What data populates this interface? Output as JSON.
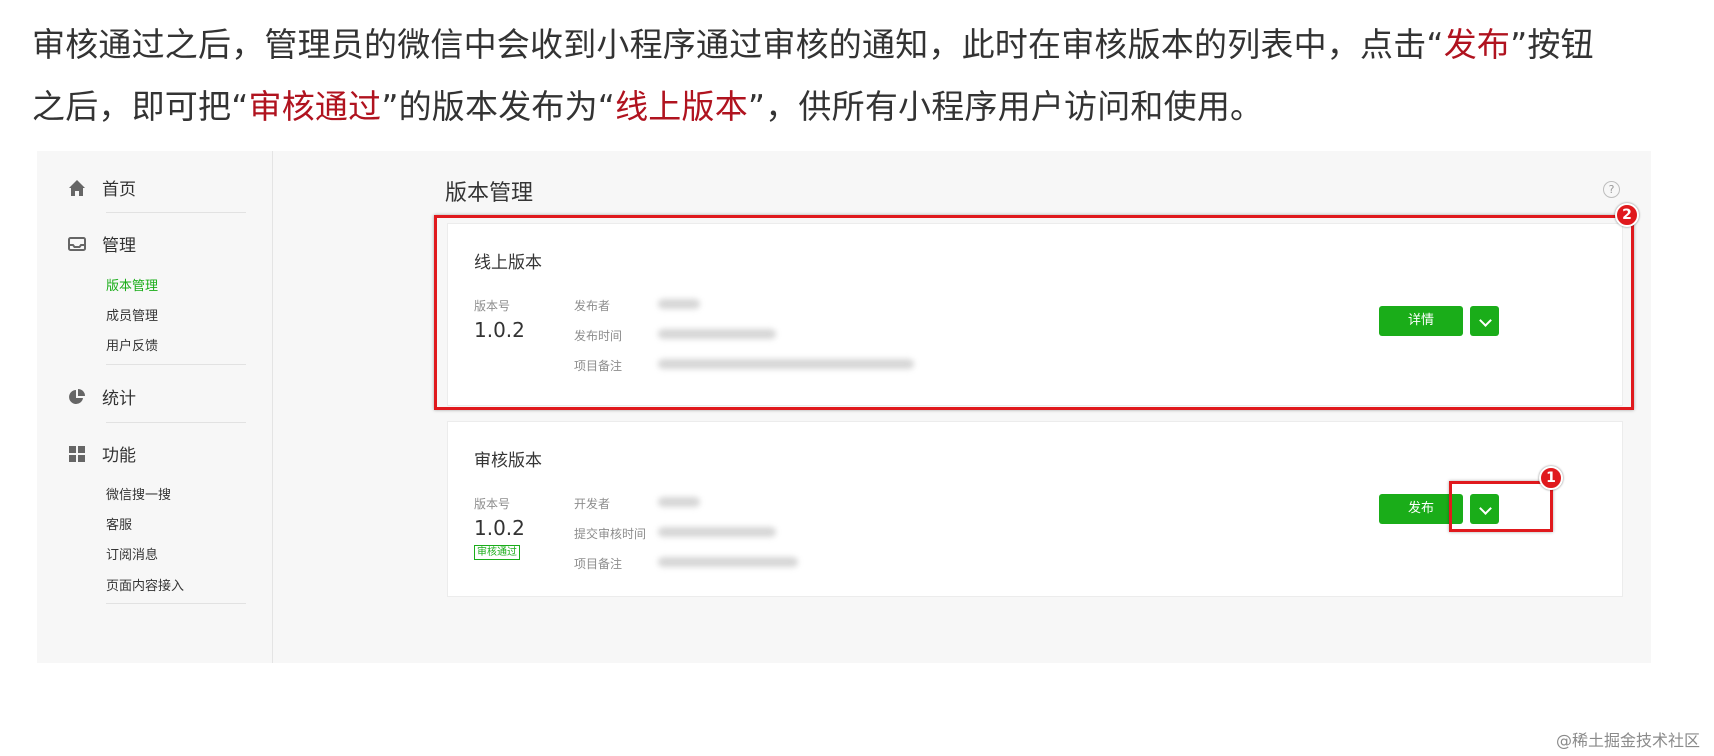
{
  "intro": {
    "line1_a": "审核通过之后，管理员的微信中会收到小程序通过审核的通知，此时在审核版本的列表中，点击“",
    "line1_hl": "发布",
    "line1_b": "”按钮",
    "line2_a": "之后，即可把“",
    "line2_hl1": "审核通过",
    "line2_b": "”的版本发布为“",
    "line2_hl2": "线上版本",
    "line2_c": "”，供所有小程序用户访问和使用。"
  },
  "sidebar": {
    "home": "首页",
    "manage": "管理",
    "manage_items": [
      "版本管理",
      "成员管理",
      "用户反馈"
    ],
    "stats": "统计",
    "features": "功能",
    "feature_items": [
      "微信搜一搜",
      "客服",
      "订阅消息",
      "页面内容接入"
    ]
  },
  "main": {
    "title": "版本管理",
    "help": "?",
    "online": {
      "title": "线上版本",
      "version_label": "版本号",
      "version": "1.0.2",
      "field1": "发布者",
      "field2": "发布时间",
      "field3": "项目备注",
      "detail_button": "详情"
    },
    "review": {
      "title": "审核版本",
      "version_label": "版本号",
      "version": "1.0.2",
      "status_badge": "审核通过",
      "field1": "开发者",
      "field2": "提交审核时间",
      "field3": "项目备注",
      "publish_button": "发布"
    }
  },
  "annotations": {
    "marker1": "1",
    "marker2": "2"
  },
  "watermark": "@稀土掘金技术社区",
  "colors": {
    "accent_green": "#1aad19",
    "highlight_red": "#b0131f",
    "annotation_red": "#e0191d"
  },
  "icons": [
    "home-icon",
    "inbox-icon",
    "pie-chart-icon",
    "grid-icon",
    "help-icon",
    "chevron-down-icon"
  ]
}
